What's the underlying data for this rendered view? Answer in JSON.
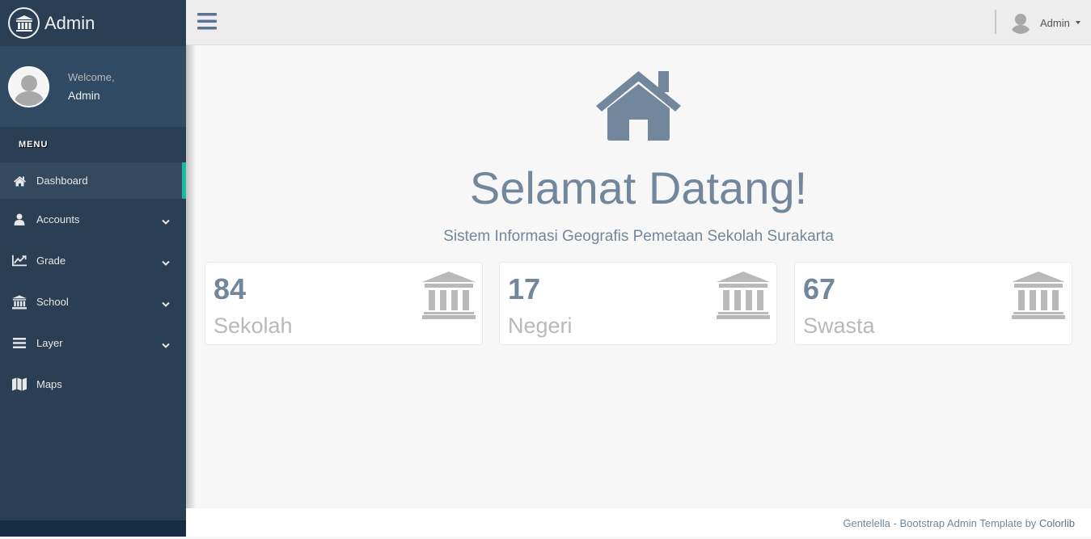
{
  "brand": {
    "title": "Admin",
    "icon": "bank-icon"
  },
  "profile": {
    "welcome": "Welcome,",
    "name": "Admin"
  },
  "sidebar": {
    "section_label": "MENU",
    "items": [
      {
        "label": "Dashboard",
        "icon": "home-icon",
        "active": true
      },
      {
        "label": "Accounts",
        "icon": "user-icon",
        "expandable": true
      },
      {
        "label": "Grade",
        "icon": "line-chart-icon",
        "expandable": true
      },
      {
        "label": "School",
        "icon": "bank-icon",
        "expandable": true
      },
      {
        "label": "Layer",
        "icon": "bars-icon",
        "expandable": true
      },
      {
        "label": "Maps",
        "icon": "map-icon"
      }
    ]
  },
  "topnav": {
    "user_name": "Admin"
  },
  "hero": {
    "title": "Selamat Datang!",
    "subtitle": "Sistem Informasi Geografis Pemetaan Sekolah Surakarta"
  },
  "stats": [
    {
      "value": "84",
      "label": "Sekolah",
      "icon": "bank-icon"
    },
    {
      "value": "17",
      "label": "Negeri",
      "icon": "bank-icon"
    },
    {
      "value": "67",
      "label": "Swasta",
      "icon": "bank-icon"
    }
  ],
  "footer": {
    "text": "Gentelella - Bootstrap Admin Template by ",
    "link": "Colorlib"
  },
  "colors": {
    "sidebar": "#2A3F54",
    "accent": "#1ABB9C",
    "text_primary": "#73879C",
    "stat_label": "#BAB8B8"
  }
}
